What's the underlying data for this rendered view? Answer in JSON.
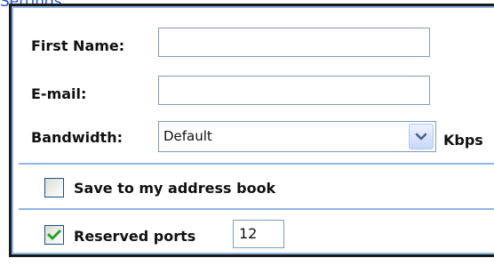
{
  "top_link": "Settings",
  "form": {
    "first_name_label": "First Name:",
    "first_name_value": "",
    "email_label": "E-mail:",
    "email_value": "",
    "bandwidth_label": "Bandwidth:",
    "bandwidth_selected": "Default",
    "bandwidth_unit": "Kbps",
    "save_checkbox_label": "Save to my address book",
    "save_checked": false,
    "reserved_ports_label": "Reserved ports",
    "reserved_ports_checked": true,
    "reserved_ports_value": "12"
  },
  "icons": {
    "dropdown": "chevron-down-icon",
    "checkmark": "checkmark-icon"
  },
  "colors": {
    "panel_border": "#1b1b1b",
    "inner_border": "#8eb6e6",
    "field_border": "#7f9db9",
    "checkmark": "#21a121",
    "link": "#1f4fd1"
  }
}
